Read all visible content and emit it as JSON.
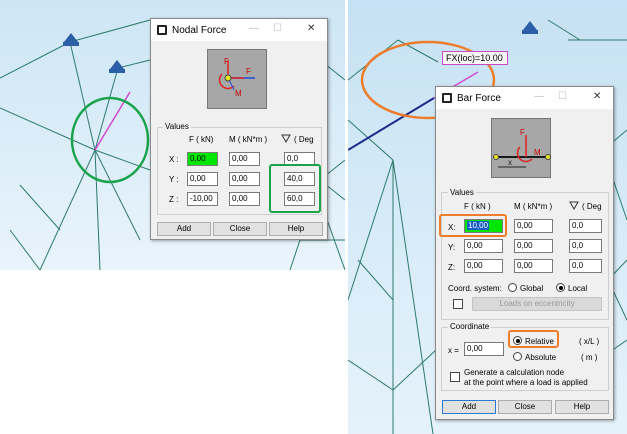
{
  "colors": {
    "highlight_green": "#1aa34a",
    "highlight_orange": "#ee7d2b",
    "active_field": "#00e600",
    "model_lines": "#2e7a6a",
    "magenta_bar": "#d24ad2",
    "dark_blue_bar": "#1d2a8a",
    "support_icon": "#2d5fa8"
  },
  "nodal_force": {
    "title": "Nodal Force",
    "icons": {
      "app": "app-window-icon",
      "minimize": "minimize-icon",
      "maximize": "maximize-icon",
      "close": "close-icon"
    },
    "preview_labels": {
      "f_top": "F",
      "f_right": "F",
      "m": "M"
    },
    "values_label": "Values",
    "col_force": "F  ( kN)",
    "col_moment": "M  ( kN*m )",
    "col_angle": "( Deg",
    "rows": [
      {
        "label": "X :",
        "force": "0,00",
        "moment": "0,00",
        "angle": "0,0"
      },
      {
        "label": "Y :",
        "force": "0,00",
        "moment": "0,00",
        "angle": "40,0"
      },
      {
        "label": "Z :",
        "force": "-10,00",
        "moment": "0,00",
        "angle": "60,0"
      }
    ],
    "buttons": {
      "add": "Add",
      "close": "Close",
      "help": "Help"
    }
  },
  "bar_force": {
    "title": "Bar Force",
    "icons": {
      "app": "app-window-icon",
      "minimize": "minimize-icon",
      "maximize": "maximize-icon",
      "close": "close-icon"
    },
    "preview_labels": {
      "f": "F",
      "m": "M",
      "x": "x"
    },
    "values_label": "Values",
    "col_force": "F  ( kN )",
    "col_moment": "M  ( kN*m )",
    "col_angle": "( Deg",
    "rows": [
      {
        "label": "X:",
        "force": "10,00",
        "moment": "0,00",
        "angle": "0,0"
      },
      {
        "label": "Y:",
        "force": "0,00",
        "moment": "0,00",
        "angle": "0,0"
      },
      {
        "label": "Z:",
        "force": "0,00",
        "moment": "0,00",
        "angle": "0,0"
      }
    ],
    "coord_system_label": "Coord. system:",
    "coord_global": "Global",
    "coord_local": "Local",
    "coord_selected": "Local",
    "loads_on_eccentricity": "Loads on eccentricity",
    "coordinate_label": "Coordinate",
    "x_label": "x =",
    "x_value": "0,00",
    "relative_label": "Relative",
    "relative_unit": "( x/L )",
    "absolute_label": "Absolute",
    "absolute_unit": "( m )",
    "position_selected": "Relative",
    "calc_node_line1": "Generate a calculation node",
    "calc_node_line2": "at the point where a load is applied",
    "buttons": {
      "add": "Add",
      "close": "Close",
      "help": "Help"
    }
  },
  "viewport_label": "FX(loc)=10.00"
}
